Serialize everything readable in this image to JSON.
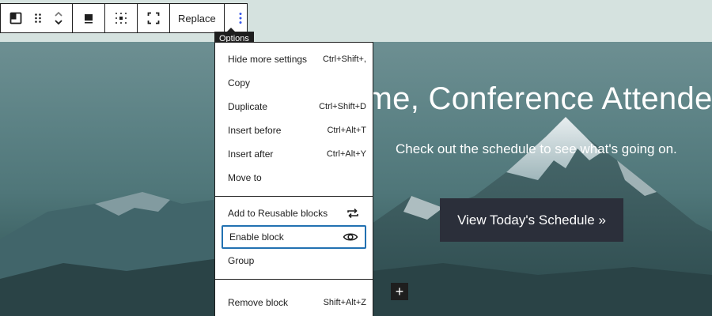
{
  "toolbar": {
    "replace_label": "Replace",
    "tooltip": "Options"
  },
  "menu": {
    "group1": [
      {
        "label": "Hide more settings",
        "shortcut": "Ctrl+Shift+,"
      },
      {
        "label": "Copy",
        "shortcut": ""
      },
      {
        "label": "Duplicate",
        "shortcut": "Ctrl+Shift+D"
      },
      {
        "label": "Insert before",
        "shortcut": "Ctrl+Alt+T"
      },
      {
        "label": "Insert after",
        "shortcut": "Ctrl+Alt+Y"
      },
      {
        "label": "Move to",
        "shortcut": ""
      }
    ],
    "group2": [
      {
        "label": "Add to Reusable blocks",
        "icon": "reusable-icon"
      },
      {
        "label": "Enable block",
        "icon": "eye-icon"
      },
      {
        "label": "Group",
        "icon": ""
      }
    ],
    "group3": [
      {
        "label": "Remove block",
        "shortcut": "Shift+Alt+Z"
      }
    ]
  },
  "hero": {
    "title": "ome, Conference Attende",
    "subtitle": "Check out the schedule to see what's going on.",
    "button_label": "View Today's Schedule »"
  },
  "colors": {
    "accent": "#3858e9",
    "focus": "#2271b1",
    "button_bg": "#2b2f3a",
    "page_bg": "#d5e2df"
  }
}
